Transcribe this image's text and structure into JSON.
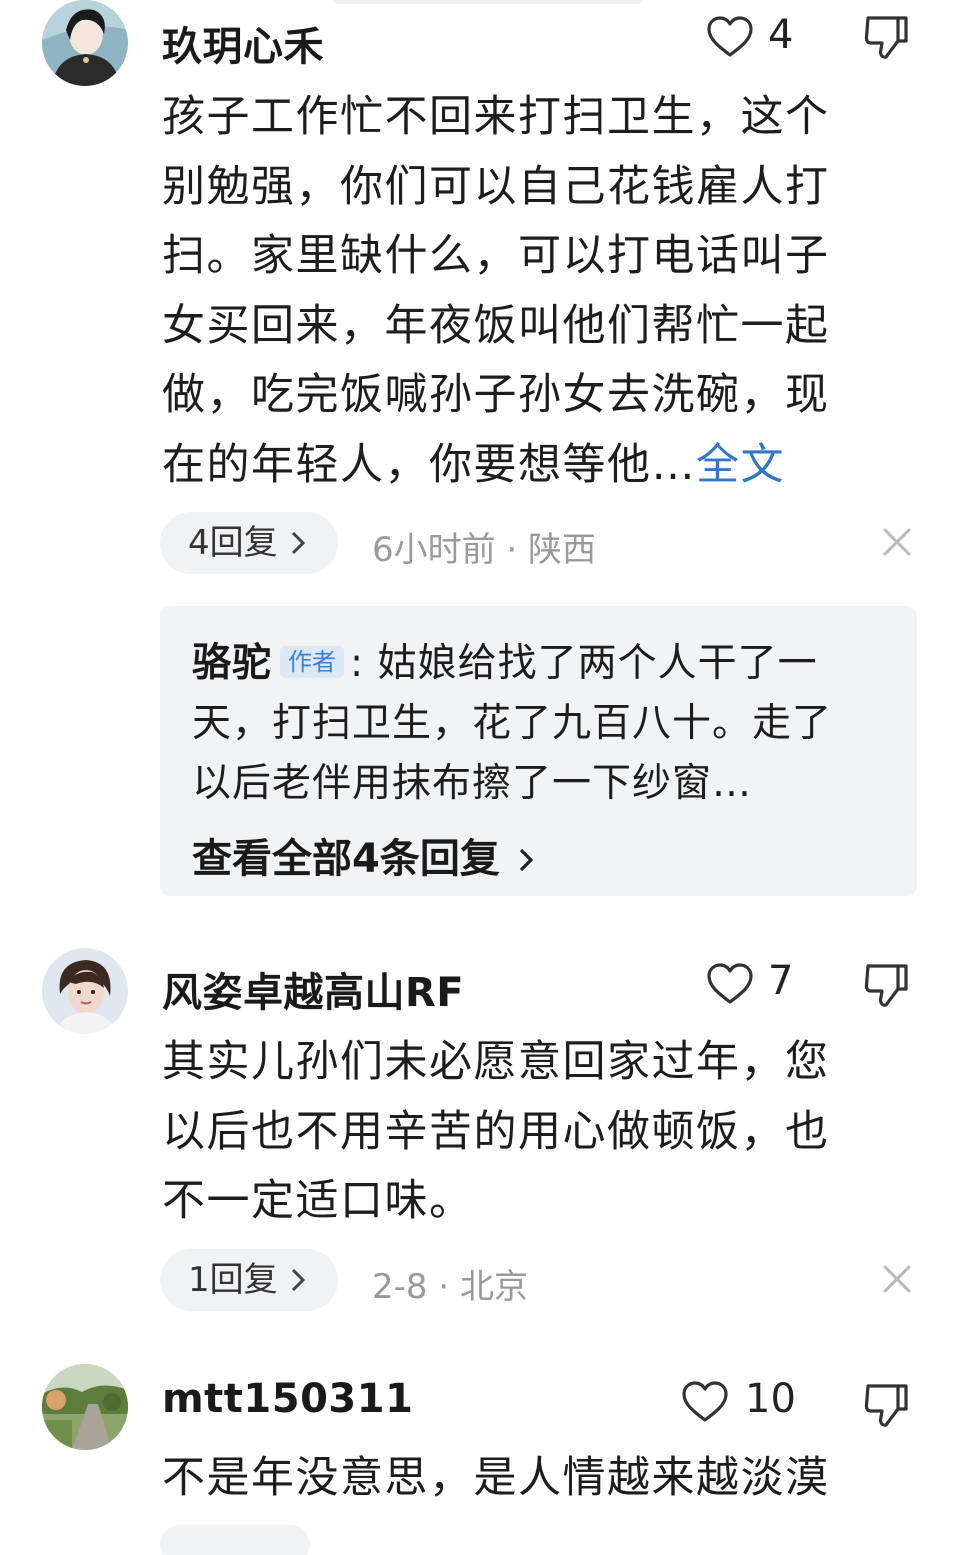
{
  "comments": [
    {
      "username": "玖玥心禾",
      "likes": "4",
      "text_lines": [
        "孩子工作忙不回来打扫卫生，这个",
        "别勉强，你们可以自己花钱雇人打",
        "扫。家里缺什么，可以打电话叫子",
        "女买回来，年夜饭叫他们帮忙一起",
        "做，吃完饭喊孙子孙女去洗碗，现",
        "在的年轻人，你要想等他…"
      ],
      "fulltext_label": "全文",
      "reply_count_label": "4回复",
      "meta": "6小时前 · 陕西",
      "reply_preview": {
        "author": "骆驼",
        "badge": "作者",
        "line1": "姑娘给找了两个人干了一",
        "line2": "天，打扫卫生，花了九百八十。走了",
        "line3": "以后老伴用抹布擦了一下纱窗…",
        "view_all": "查看全部4条回复"
      }
    },
    {
      "username": "风姿卓越高山RF",
      "likes": "7",
      "text_lines": [
        "其实儿孙们未必愿意回家过年，您",
        "以后也不用辛苦的用心做顿饭，也",
        "不一定适口味。"
      ],
      "reply_count_label": "1回复",
      "meta": "2-8 · 北京"
    },
    {
      "username": "mtt150311",
      "likes": "10",
      "text_lines": [
        "不是年没意思，是人情越来越淡漠"
      ]
    }
  ],
  "icons": {
    "like": "heart-outline-icon",
    "dislike": "thumbs-down-icon",
    "close": "close-x-icon",
    "chevron": "chevron-right-icon"
  },
  "colors": {
    "link": "#2f78c8",
    "meta": "#9a9a9a",
    "pill_bg": "#f1f2f4",
    "badge_text": "#3e7fd0"
  }
}
